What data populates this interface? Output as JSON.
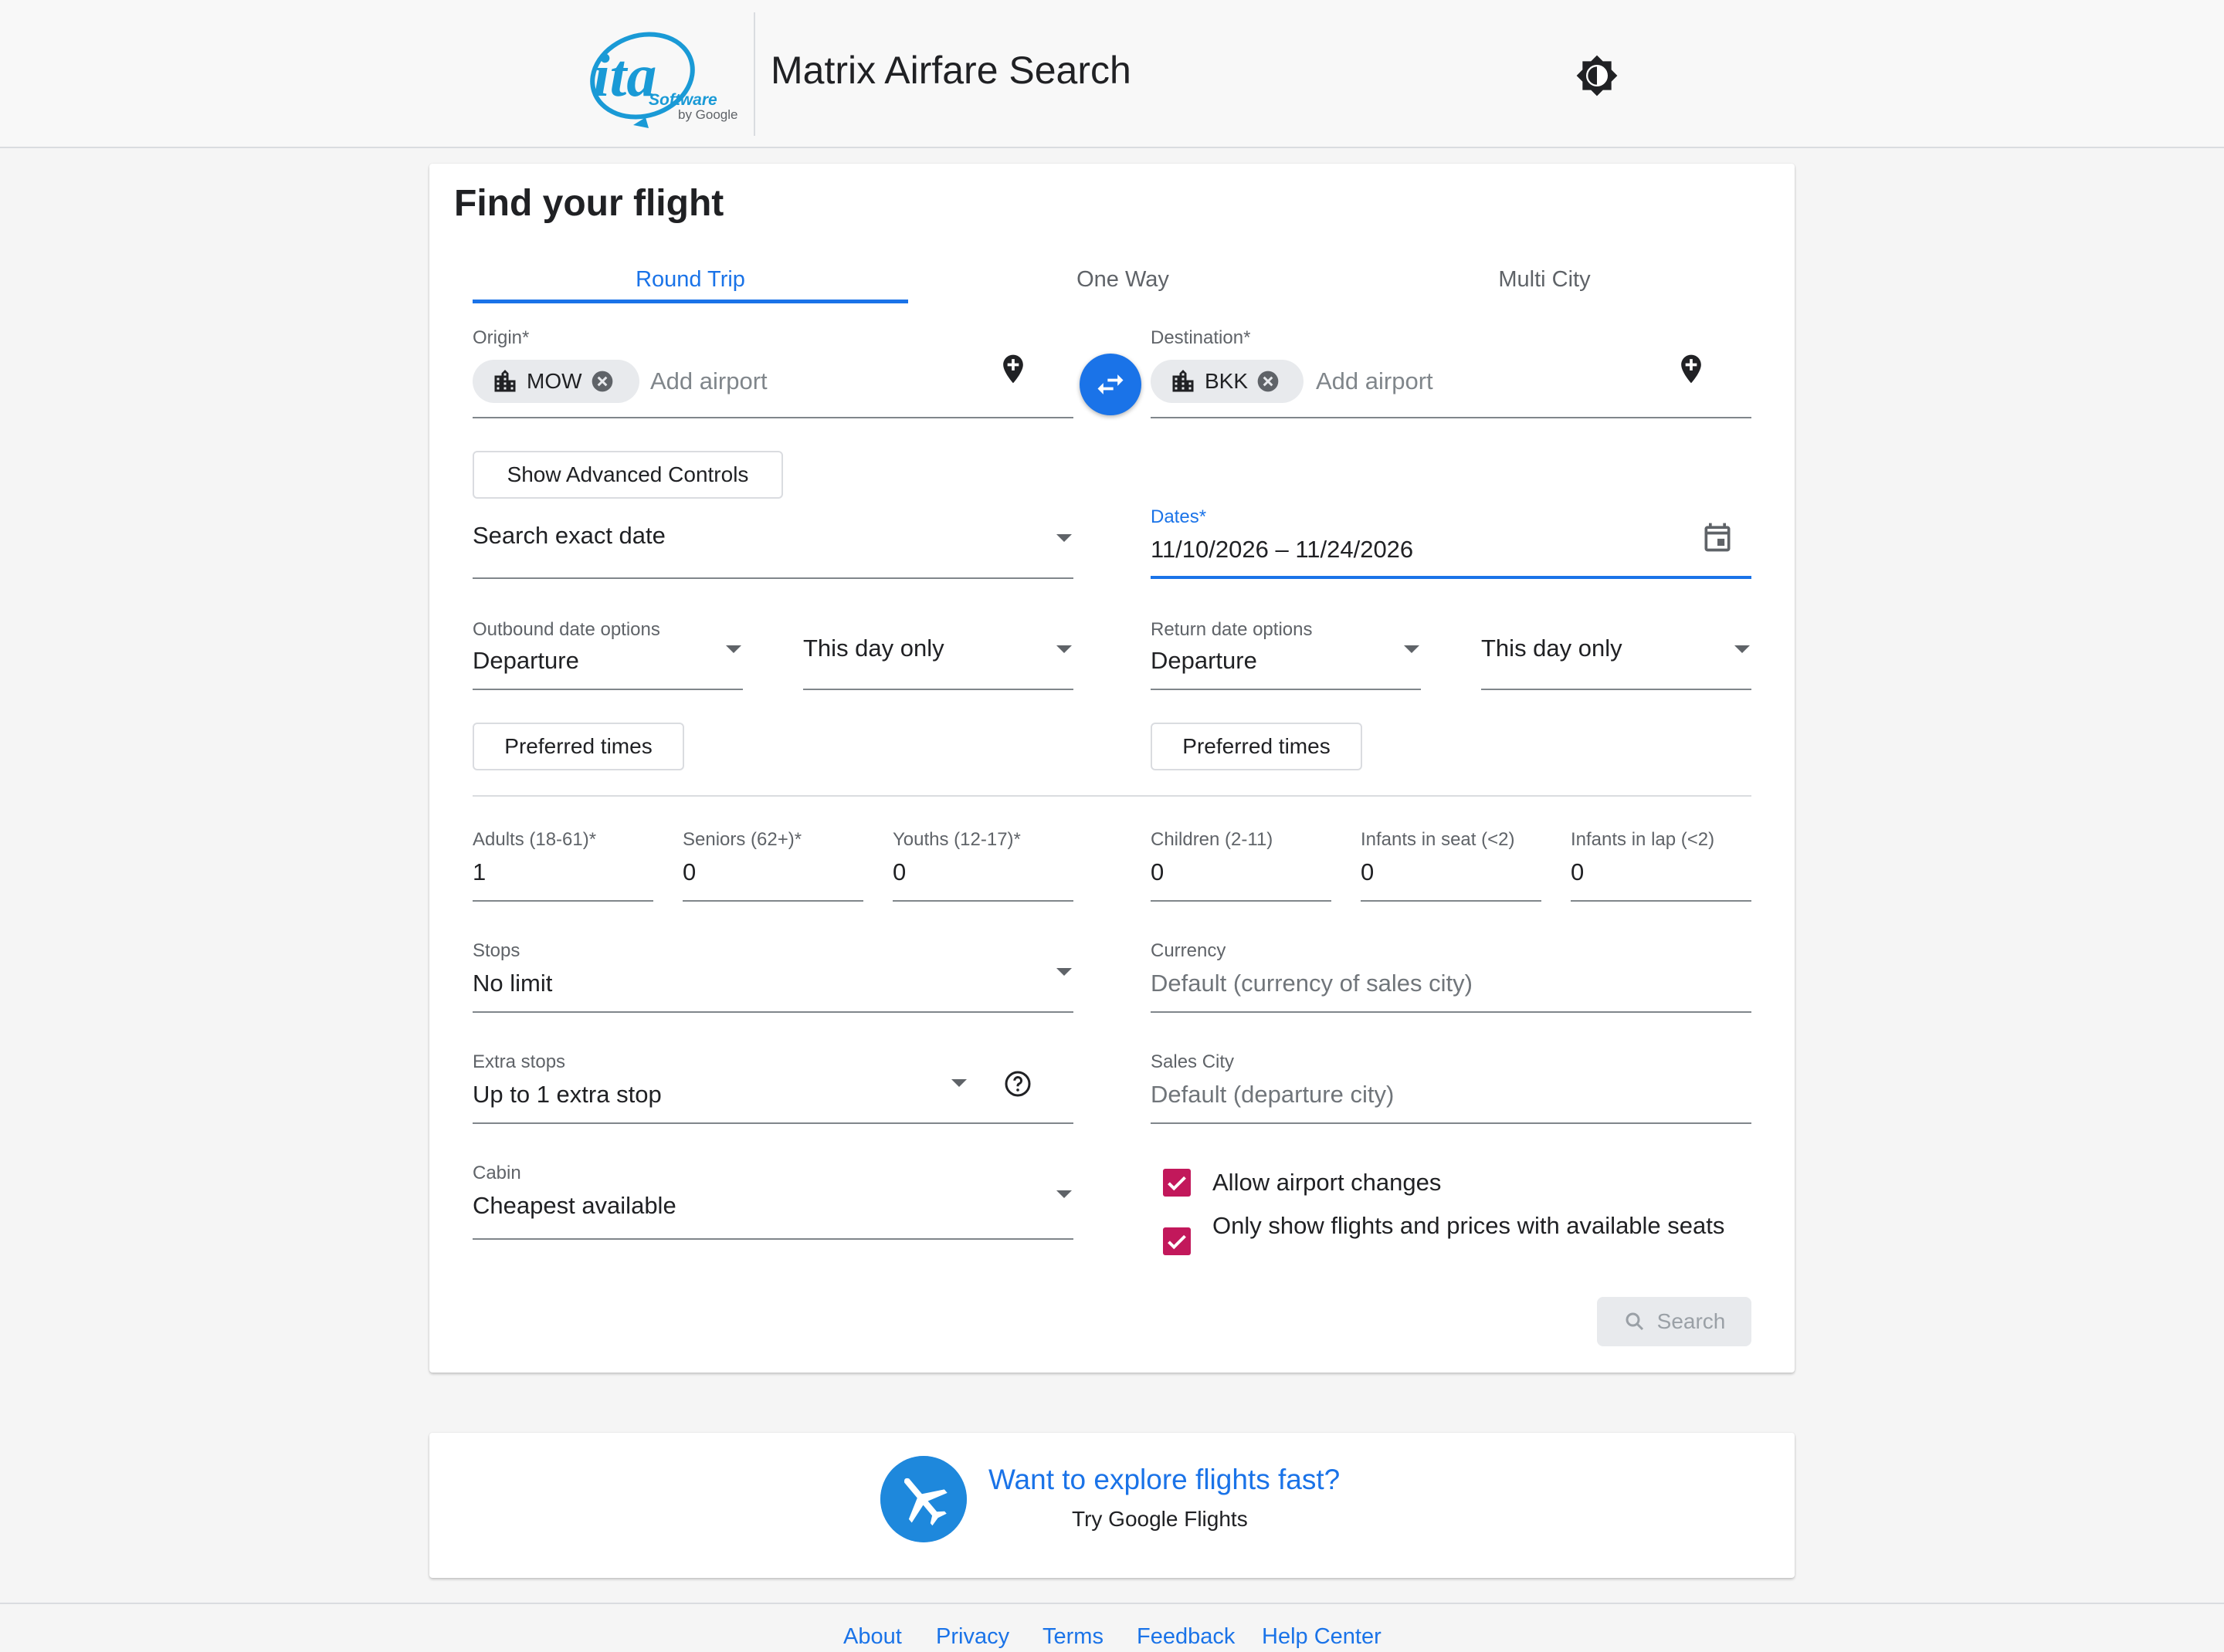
{
  "header": {
    "logo_text": "ita",
    "logo_sub": "Software",
    "logo_by": "by Google",
    "title": "Matrix Airfare Search"
  },
  "form": {
    "title": "Find your flight",
    "tabs": [
      {
        "label": "Round Trip",
        "active": true
      },
      {
        "label": "One Way",
        "active": false
      },
      {
        "label": "Multi City",
        "active": false
      }
    ],
    "origin": {
      "label": "Origin*",
      "chip": "MOW",
      "placeholder": "Add airport"
    },
    "destination": {
      "label": "Destination*",
      "chip": "BKK",
      "placeholder": "Add airport"
    },
    "advanced_button": "Show Advanced Controls",
    "date_search": {
      "value": "Search exact date"
    },
    "dates": {
      "label": "Dates*",
      "value": "11/10/2026 – 11/24/2026"
    },
    "outbound": {
      "label": "Outbound date options",
      "type": "Departure",
      "range": "This day only",
      "times_button": "Preferred times"
    },
    "return": {
      "label": "Return date options",
      "type": "Departure",
      "range": "This day only",
      "times_button": "Preferred times"
    },
    "passengers": [
      {
        "label": "Adults (18-61)*",
        "value": "1"
      },
      {
        "label": "Seniors (62+)*",
        "value": "0"
      },
      {
        "label": "Youths (12-17)*",
        "value": "0"
      },
      {
        "label": "Children (2-11)",
        "value": "0"
      },
      {
        "label": "Infants in seat (<2)",
        "value": "0"
      },
      {
        "label": "Infants in lap (<2)",
        "value": "0"
      }
    ],
    "stops": {
      "label": "Stops",
      "value": "No limit"
    },
    "currency": {
      "label": "Currency",
      "value": "Default (currency of sales city)"
    },
    "extra_stops": {
      "label": "Extra stops",
      "value": "Up to 1 extra stop"
    },
    "sales_city": {
      "label": "Sales City",
      "value": "Default (departure city)"
    },
    "cabin": {
      "label": "Cabin",
      "value": "Cheapest available"
    },
    "checkboxes": [
      {
        "label": "Allow airport changes",
        "checked": true
      },
      {
        "label": "Only show flights and prices with available seats",
        "checked": true
      }
    ],
    "search_button": "Search"
  },
  "promo": {
    "title": "Want to explore flights fast?",
    "subtitle": "Try Google Flights"
  },
  "footer": {
    "links": [
      "About",
      "Privacy",
      "Terms",
      "Feedback",
      "Help Center"
    ]
  },
  "colors": {
    "accent": "#1a73e8",
    "checkbox": "#c2185b",
    "logo": "#1a9ad6"
  }
}
